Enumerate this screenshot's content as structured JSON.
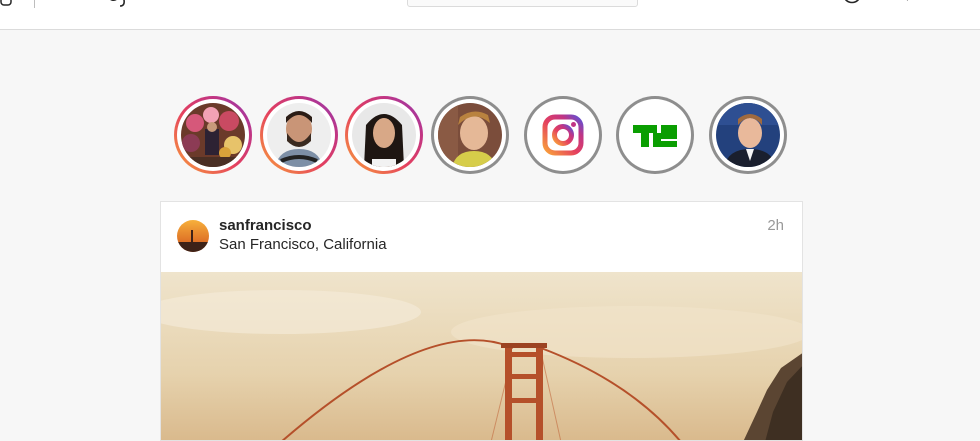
{
  "header": {
    "logo_icon": "instagram-glyph-icon",
    "search": {
      "placeholder": ""
    },
    "nav_icons": [
      "compass-icon",
      "heart-icon"
    ]
  },
  "stories": [
    {
      "name": "story-flowers",
      "ring": "unseen"
    },
    {
      "name": "story-bearded-man",
      "ring": "unseen"
    },
    {
      "name": "story-woman",
      "ring": "unseen"
    },
    {
      "name": "story-young-man",
      "ring": "seen"
    },
    {
      "name": "story-instagram",
      "ring": "seen",
      "icon": "instagram-logo-icon"
    },
    {
      "name": "story-techcrunch",
      "ring": "seen",
      "icon": "techcrunch-logo-icon"
    },
    {
      "name": "story-zuckerberg",
      "ring": "seen"
    }
  ],
  "post": {
    "username": "sanfrancisco",
    "location": "San Francisco, California",
    "time": "2h",
    "image_subject": "golden-gate-bridge"
  },
  "colors": {
    "story_gradient": [
      "#f9a23a",
      "#e4405f",
      "#c13584",
      "#8a3ab9"
    ],
    "seen_ring": "#8e8e8e",
    "techcrunch_green": "#0a9e01",
    "bridge": "#b5502a",
    "sky": "#e7d6b8"
  }
}
